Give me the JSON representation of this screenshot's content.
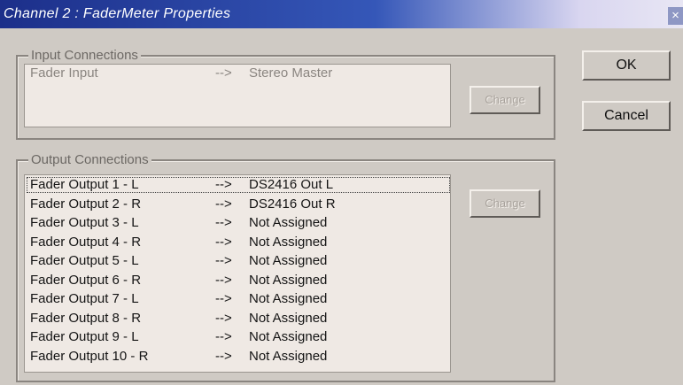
{
  "window": {
    "title": "Channel 2 : FaderMeter Properties",
    "close_glyph": "×"
  },
  "input_connections": {
    "label": "Input Connections",
    "rows": [
      {
        "source": "Fader Input",
        "arrow": "-->",
        "target": "Stereo Master"
      }
    ],
    "change_button": "Change"
  },
  "output_connections": {
    "label": "Output Connections",
    "change_button": "Change",
    "rows": [
      {
        "source": "Fader Output 1 - L",
        "arrow": "-->",
        "target": "DS2416 Out L"
      },
      {
        "source": "Fader Output 2 - R",
        "arrow": "-->",
        "target": "DS2416 Out R"
      },
      {
        "source": "Fader Output 3 - L",
        "arrow": "-->",
        "target": "Not Assigned"
      },
      {
        "source": "Fader Output 4 - R",
        "arrow": "-->",
        "target": "Not Assigned"
      },
      {
        "source": "Fader Output 5 - L",
        "arrow": "-->",
        "target": "Not Assigned"
      },
      {
        "source": "Fader Output 6 - R",
        "arrow": "-->",
        "target": "Not Assigned"
      },
      {
        "source": "Fader Output 7 - L",
        "arrow": "-->",
        "target": "Not Assigned"
      },
      {
        "source": "Fader Output 8 - R",
        "arrow": "-->",
        "target": "Not Assigned"
      },
      {
        "source": "Fader Output 9 - L",
        "arrow": "-->",
        "target": "Not Assigned"
      },
      {
        "source": "Fader Output 10 - R",
        "arrow": "-->",
        "target": "Not Assigned"
      }
    ]
  },
  "buttons": {
    "ok": "OK",
    "cancel": "Cancel"
  }
}
